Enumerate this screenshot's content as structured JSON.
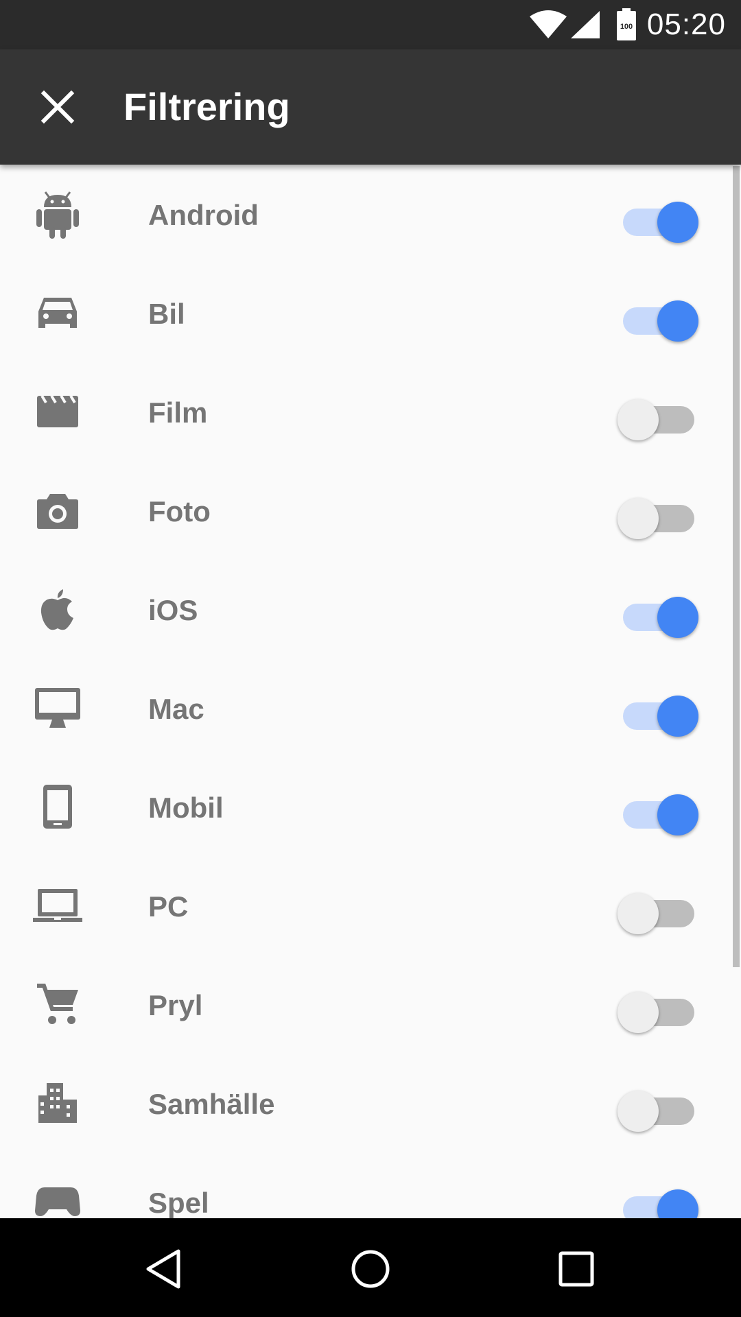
{
  "status_bar": {
    "time": "05:20",
    "battery_level": "100",
    "icons": [
      "wifi-icon",
      "cell-signal-icon",
      "battery-icon"
    ]
  },
  "toolbar": {
    "title": "Filtrering",
    "close_icon": "close-icon"
  },
  "colors": {
    "toolbar": "#353535",
    "status_bar": "#2b2b2b",
    "accent": "#4285f4",
    "accent_track": "#c7d9fb",
    "icon": "#757575",
    "label": "#757575",
    "background": "#fafafa"
  },
  "filters": [
    {
      "label": "Android",
      "icon": "android-icon",
      "enabled": true
    },
    {
      "label": "Bil",
      "icon": "car-icon",
      "enabled": true
    },
    {
      "label": "Film",
      "icon": "movie-clapper-icon",
      "enabled": false
    },
    {
      "label": "Foto",
      "icon": "camera-icon",
      "enabled": false
    },
    {
      "label": "iOS",
      "icon": "apple-icon",
      "enabled": true
    },
    {
      "label": "Mac",
      "icon": "desktop-mac-icon",
      "enabled": true
    },
    {
      "label": "Mobil",
      "icon": "smartphone-icon",
      "enabled": true
    },
    {
      "label": "PC",
      "icon": "laptop-icon",
      "enabled": false
    },
    {
      "label": "Pryl",
      "icon": "shopping-cart-icon",
      "enabled": false
    },
    {
      "label": "Samhälle",
      "icon": "city-icon",
      "enabled": false
    },
    {
      "label": "Spel",
      "icon": "gamepad-icon",
      "enabled": true
    }
  ],
  "nav_bar": {
    "icons": [
      "back-icon",
      "home-icon",
      "recents-icon"
    ]
  }
}
